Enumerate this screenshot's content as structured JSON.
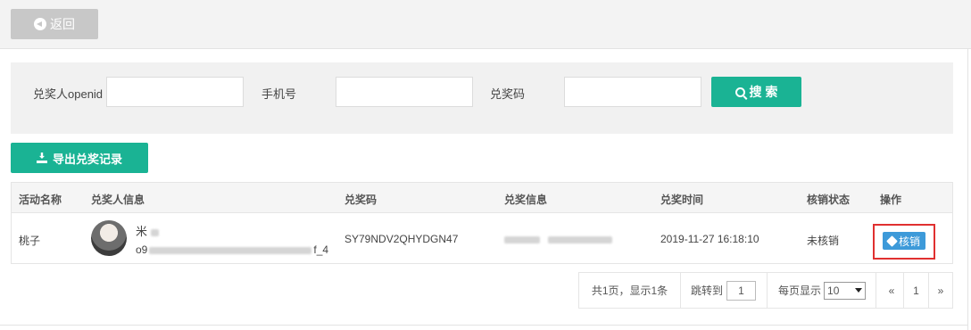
{
  "header": {
    "back_label": "返回"
  },
  "search": {
    "openid_label": "兑奖人openid",
    "phone_label": "手机号",
    "code_label": "兑奖码",
    "search_label": "搜 索",
    "openid_value": "",
    "phone_value": "",
    "code_value": ""
  },
  "toolbar": {
    "export_label": "导出兑奖记录"
  },
  "table": {
    "headers": [
      "活动名称",
      "兑奖人信息",
      "兑奖码",
      "兑奖信息",
      "兑奖时间",
      "核销状态",
      "操作"
    ],
    "rows": [
      {
        "activity": "桃子",
        "winner_name": "米",
        "winner_openid_prefix": "o9",
        "winner_openid_suffix": "f_4",
        "code": "SY79NDV2QHYDGN47",
        "time": "2019-11-27 16:18:10",
        "status": "未核销",
        "action": "核销"
      }
    ]
  },
  "pager": {
    "summary": "共1页，显示1条",
    "jump_label": "跳转到",
    "jump_value": "1",
    "per_page_label": "每页显示",
    "per_page_value": "10",
    "prev": "«",
    "current": "1",
    "next": "»"
  },
  "colors": {
    "primary": "#1ab394",
    "action_blue": "#3d9ad9",
    "highlight_red": "#e03030"
  }
}
